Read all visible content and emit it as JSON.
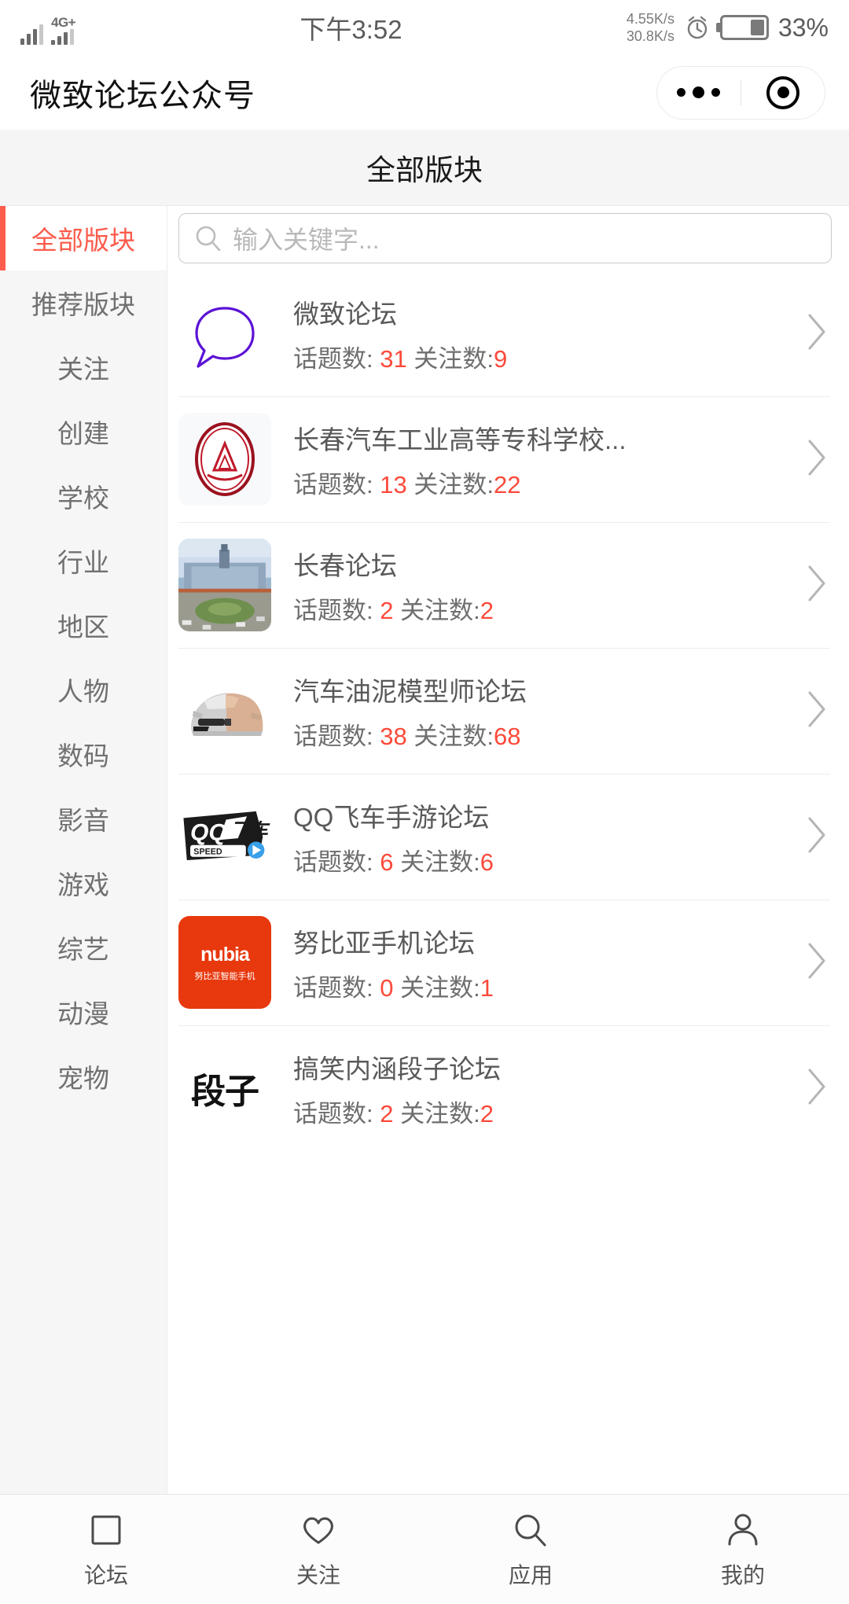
{
  "status_bar": {
    "carrier_badge": "4G+",
    "time": "下午3:52",
    "net_up": "4.55K/s",
    "net_down": "30.8K/s",
    "battery_percent": "33%",
    "icons": [
      "signal-icon",
      "signal-dual-icon",
      "alarm-icon",
      "battery-icon"
    ]
  },
  "mp_header": {
    "title": "微致论坛公众号",
    "more_icon": "more-dots-icon",
    "close_icon": "target-circle-icon"
  },
  "page": {
    "title": "全部版块"
  },
  "sidebar": {
    "items": [
      {
        "label": "全部版块",
        "active": true
      },
      {
        "label": "推荐版块",
        "active": false
      },
      {
        "label": "关注",
        "active": false
      },
      {
        "label": "创建",
        "active": false
      },
      {
        "label": "学校",
        "active": false
      },
      {
        "label": "行业",
        "active": false
      },
      {
        "label": "地区",
        "active": false
      },
      {
        "label": "人物",
        "active": false
      },
      {
        "label": "数码",
        "active": false
      },
      {
        "label": "影音",
        "active": false
      },
      {
        "label": "游戏",
        "active": false
      },
      {
        "label": "综艺",
        "active": false
      },
      {
        "label": "动漫",
        "active": false
      },
      {
        "label": "宠物",
        "active": false
      }
    ]
  },
  "search": {
    "placeholder": "输入关键字...",
    "value": "",
    "icon": "search-icon"
  },
  "list": {
    "topic_label": "话题数:",
    "follow_label": "关注数:",
    "items": [
      {
        "name": "微致论坛",
        "topics": "31",
        "follows": "9",
        "thumb": "bubble",
        "chevron": "chevron-right-icon"
      },
      {
        "name": "长春汽车工业高等专科学校...",
        "topics": "13",
        "follows": "22",
        "thumb": "school",
        "chevron": "chevron-right-icon"
      },
      {
        "name": "长春论坛",
        "topics": "2",
        "follows": "2",
        "thumb": "city",
        "chevron": "chevron-right-icon"
      },
      {
        "name": "汽车油泥模型师论坛",
        "topics": "38",
        "follows": "68",
        "thumb": "clay",
        "chevron": "chevron-right-icon"
      },
      {
        "name": "QQ飞车手游论坛",
        "topics": "6",
        "follows": "6",
        "thumb": "qq",
        "chevron": "chevron-right-icon"
      },
      {
        "name": "努比亚手机论坛",
        "topics": "0",
        "follows": "1",
        "thumb": "nubia",
        "chevron": "chevron-right-icon"
      },
      {
        "name": "搞笑内涵段子论坛",
        "topics": "2",
        "follows": "2",
        "thumb": "duanzi",
        "chevron": "chevron-right-icon"
      }
    ]
  },
  "thumb_text": {
    "nubia_word": "nubia",
    "nubia_sub": "努比亚智能手机",
    "duanzi_word": "段子"
  },
  "tabbar": {
    "items": [
      {
        "label": "论坛",
        "icon": "forum-square-icon"
      },
      {
        "label": "关注",
        "icon": "heart-icon"
      },
      {
        "label": "应用",
        "icon": "search-icon"
      },
      {
        "label": "我的",
        "icon": "person-icon"
      }
    ]
  },
  "colors": {
    "accent_red": "#fc5c4c",
    "number_red": "#fc4a3a",
    "text_gray": "#707070",
    "bg_gray": "#f5f5f5"
  }
}
